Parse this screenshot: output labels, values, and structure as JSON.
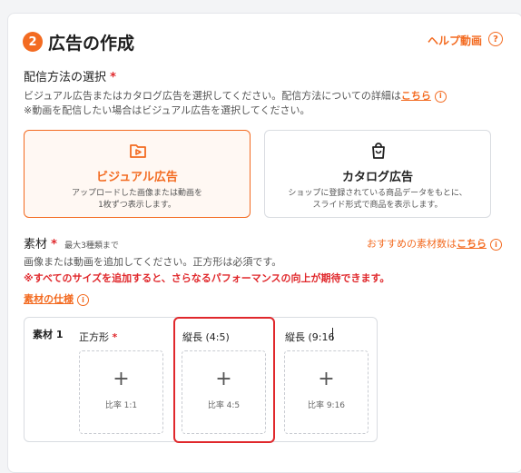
{
  "header": {
    "step_number": "2",
    "title": "広告の作成",
    "help_link": "ヘルプ動画"
  },
  "delivery": {
    "label": "配信方法の選択",
    "required_mark": "*",
    "description_line1": "ビジュアル広告またはカタログ広告を選択してください。配信方法についての詳細は",
    "description_link": "こちら",
    "description_line2": "※動画を配信したい場合はビジュアル広告を選択してください。",
    "options": [
      {
        "title": "ビジュアル広告",
        "desc_line1": "アップロードした画像または動画を",
        "desc_line2": "1枚ずつ表示します。",
        "selected": true,
        "icon": "video-folder-icon"
      },
      {
        "title": "カタログ広告",
        "desc_line1": "ショップに登録されている商品データをもとに、",
        "desc_line2": "スライド形式で商品を表示します。",
        "selected": false,
        "icon": "shopping-bag-icon"
      }
    ]
  },
  "material": {
    "label": "素材",
    "required_mark": "*",
    "max_note": "最大3種類まで",
    "recommend_text": "おすすめの素材数は",
    "recommend_link": "こちら",
    "desc": "画像または動画を追加してください。正方形は必須です。",
    "warning": "※すべてのサイズを追加すると、さらなるパフォーマンスの向上が期待できます。",
    "spec_link": "素材の仕様",
    "row_label": "素材 1",
    "slots": [
      {
        "label": "正方形",
        "required": "*",
        "plus": "+",
        "ratio": "比率 1:1"
      },
      {
        "label": "縦長 (4:5)",
        "required": "",
        "plus": "+",
        "ratio": "比率 4:5"
      },
      {
        "label": "縦長 (9:16",
        "required": "",
        "plus": "+",
        "ratio": "比率 9:16"
      }
    ]
  },
  "colors": {
    "accent": "#f36b21",
    "required": "#e0282c",
    "highlight": "#e0282c"
  }
}
